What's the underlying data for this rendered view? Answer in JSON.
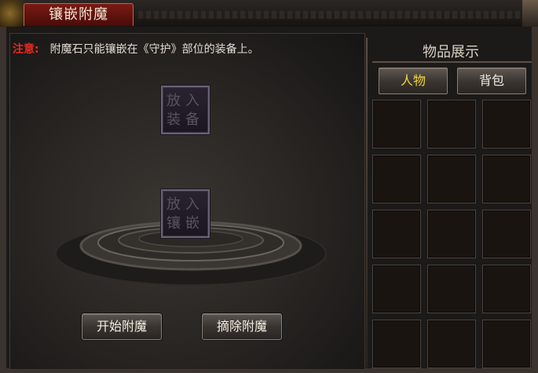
{
  "window": {
    "title": "镶嵌附魔"
  },
  "notice": {
    "label": "注意:",
    "text": "附魔石只能镶嵌在《守护》部位的装备上。"
  },
  "slots": {
    "equip": {
      "line1": "放入",
      "line2": "装备"
    },
    "gem": {
      "line1": "放入",
      "line2": "镶嵌"
    }
  },
  "buttons": {
    "start": "开始附魔",
    "remove": "摘除附魔"
  },
  "item_panel": {
    "title": "物品展示",
    "tabs": [
      {
        "label": "人物",
        "active": true
      },
      {
        "label": "背包",
        "active": false
      }
    ]
  },
  "colors": {
    "notice_label": "#e82a1e",
    "active_tab_text": "#f2d640",
    "title_tab_bg": "#7a1a14"
  }
}
